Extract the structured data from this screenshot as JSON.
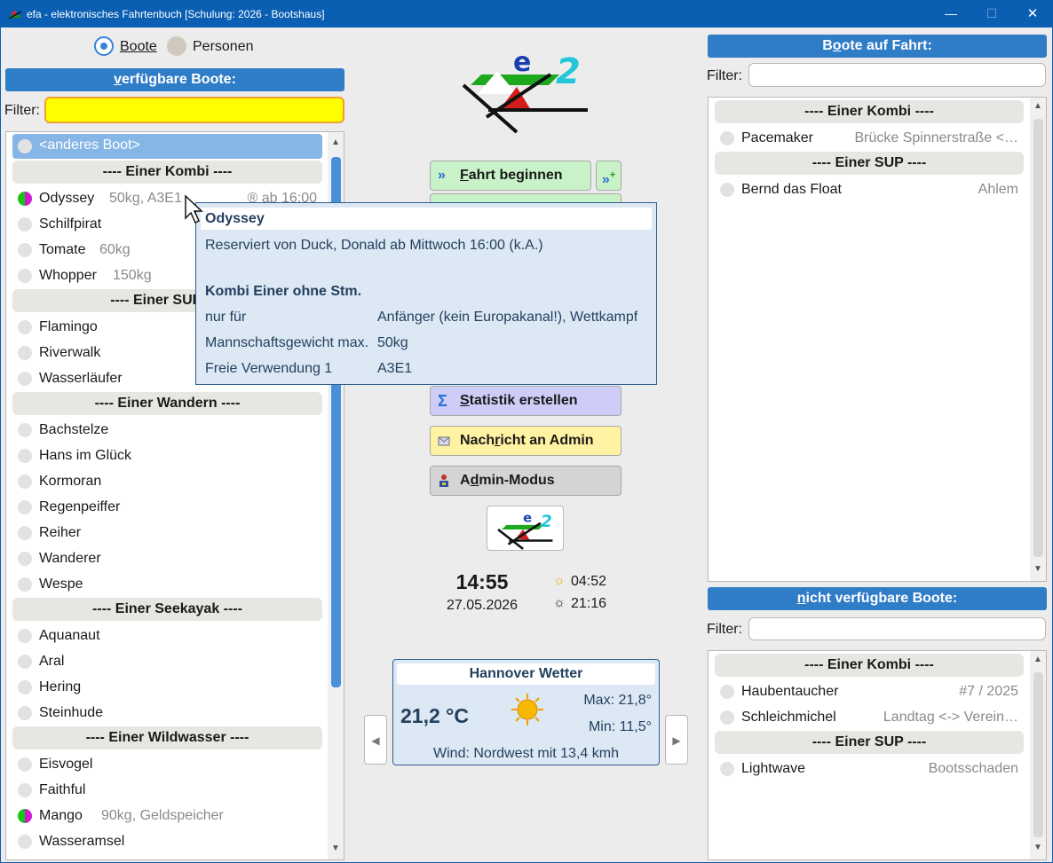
{
  "window": {
    "title": "efa - elektronisches Fahrtenbuch [Schulung: 2026 - Bootshaus]",
    "min": "—",
    "max": "☐",
    "close": "✕"
  },
  "mode": {
    "boats": "Boote",
    "persons": "Personen"
  },
  "left": {
    "header_pre": "",
    "header_u": "v",
    "header_rest": "erfügbare Boote:",
    "filter_label": "Filter:",
    "other_boat": "<anderes Boot>",
    "groups": [
      {
        "title": "----  Einer Kombi  ----"
      },
      {
        "title": "----  Einer SUP  ----"
      },
      {
        "title": "----  Einer Wandern  ----"
      },
      {
        "title": "----  Einer Seekayak  ----"
      },
      {
        "title": "----  Einer Wildwasser  ----"
      }
    ],
    "rows": [
      {
        "name": "Odyssey",
        "info": "50kg, A3E1",
        "right": "® ab 16:00"
      },
      {
        "name": "Schilfpirat",
        "info": "",
        "right": ""
      },
      {
        "name": "Tomate",
        "info": "60kg",
        "right": ""
      },
      {
        "name": "Whopper",
        "info": "150kg",
        "right": ""
      },
      {
        "name": "Flamingo",
        "info": "",
        "right": ""
      },
      {
        "name": "Riverwalk",
        "info": "",
        "right": ""
      },
      {
        "name": "Wasserläufer",
        "info": "",
        "right": ""
      },
      {
        "name": "Bachstelze",
        "info": "",
        "right": ""
      },
      {
        "name": "Hans im Glück",
        "info": "",
        "right": ""
      },
      {
        "name": "Kormoran",
        "info": "",
        "right": ""
      },
      {
        "name": "Regenpeiffer",
        "info": "",
        "right": ""
      },
      {
        "name": "Reiher",
        "info": "",
        "right": ""
      },
      {
        "name": "Wanderer",
        "info": "",
        "right": ""
      },
      {
        "name": "Wespe",
        "info": "",
        "right": ""
      },
      {
        "name": "Aquanaut",
        "info": "",
        "right": ""
      },
      {
        "name": "Aral",
        "info": "",
        "right": ""
      },
      {
        "name": "Hering",
        "info": "",
        "right": ""
      },
      {
        "name": "Steinhude",
        "info": "",
        "right": ""
      },
      {
        "name": "Eisvogel",
        "info": "",
        "right": ""
      },
      {
        "name": "Faithful",
        "info": "",
        "right": ""
      },
      {
        "name": "Mango",
        "info": "90kg, Geldspeicher",
        "right": ""
      },
      {
        "name": "Wasseramsel",
        "info": "",
        "right": ""
      }
    ]
  },
  "center": {
    "start_trip_u": "F",
    "start_trip_rest": "ahrt beginnen",
    "stats_u": "S",
    "stats_rest": "tatistik erstellen",
    "msg_pre": "Nach",
    "msg_u": "r",
    "msg_rest": "icht an Admin",
    "admin_pre": "A",
    "admin_u": "d",
    "admin_rest": "min-Modus",
    "time": "14:55",
    "date": "27.05.2026",
    "sunrise": "04:52",
    "sunset": "21:16"
  },
  "tooltip": {
    "title": "Odyssey",
    "reserved": "Reserviert von Duck, Donald ab Mittwoch 16:00 (k.A.)",
    "type": "Kombi Einer ohne Stm.",
    "rows": [
      {
        "k": "nur für",
        "v": "Anfänger (kein Europakanal!), Wettkampf"
      },
      {
        "k": "Mannschaftsgewicht max.",
        "v": "50kg"
      },
      {
        "k": "Freie Verwendung 1",
        "v": "A3E1"
      }
    ]
  },
  "weather": {
    "title": "Hannover Wetter",
    "temp": "21,2 °C",
    "max": "Max: 21,8°",
    "min": "Min: 11,5°",
    "wind": "Wind: Nordwest mit 13,4 kmh"
  },
  "right": {
    "on_trip_pre": "B",
    "on_trip_u": "o",
    "on_trip_rest": "ote auf Fahrt:",
    "filter_label": "Filter:",
    "on_trip_groups": [
      {
        "title": "----  Einer Kombi  ----"
      },
      {
        "title": "----  Einer SUP  ----"
      }
    ],
    "on_trip_rows": [
      {
        "name": "Pacemaker",
        "right": "Brücke Spinnerstraße <…"
      },
      {
        "name": "Bernd das Float",
        "right": "Ahlem"
      }
    ],
    "na_u": "n",
    "na_rest": "icht verfügbare Boote:",
    "na_groups": [
      {
        "title": "----  Einer Kombi  ----"
      },
      {
        "title": "----  Einer SUP  ----"
      }
    ],
    "na_rows": [
      {
        "name": "Haubentaucher",
        "right": "#7 / 2025"
      },
      {
        "name": "Schleichmichel",
        "right": "Landtag <-> Verein…"
      },
      {
        "name": "Lightwave",
        "right": "Bootsschaden"
      }
    ]
  }
}
